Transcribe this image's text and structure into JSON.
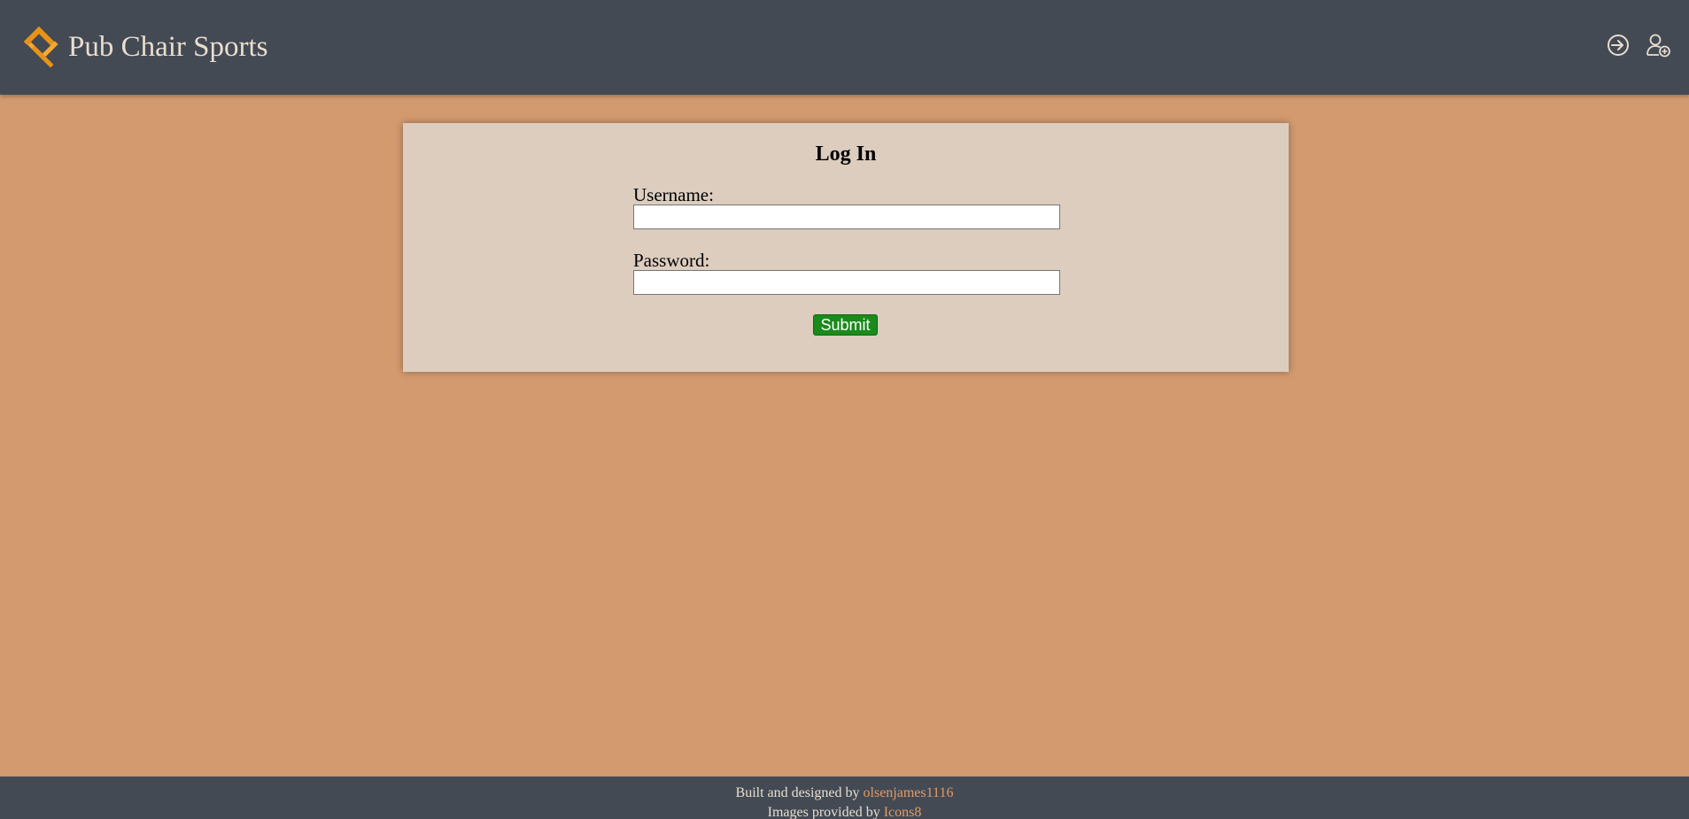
{
  "header": {
    "brand_title": "Pub Chair Sports",
    "logo_icon": "chair-logo-icon",
    "actions": [
      {
        "icon": "login-icon",
        "purpose": "log in"
      },
      {
        "icon": "add-user-icon",
        "purpose": "register"
      }
    ]
  },
  "login_form": {
    "title": "Log In",
    "username_label": "Username:",
    "username_value": "",
    "password_label": "Password:",
    "password_value": "",
    "submit_label": "Submit"
  },
  "footer": {
    "built_prefix": "Built and designed by",
    "built_author": "olsenjames1116",
    "images_prefix": "Images provided by",
    "images_source": "Icons8"
  },
  "colors": {
    "background": "#d39a6f",
    "navbar": "#434a54",
    "card": "#dccdbf",
    "submit": "#1b8a1c",
    "link": "#e59a62",
    "logo": "#f29a1b"
  }
}
